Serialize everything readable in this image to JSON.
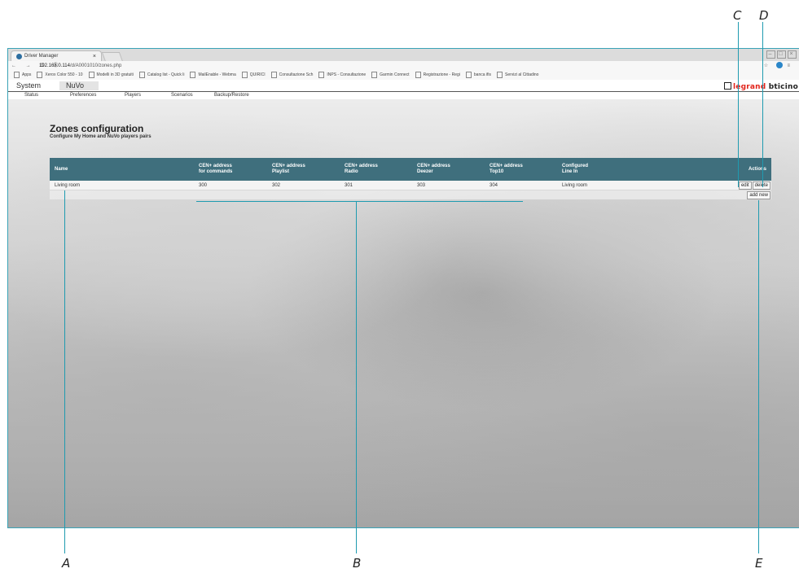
{
  "callouts": {
    "a": "A",
    "b": "B",
    "c": "C",
    "d": "D",
    "e": "E"
  },
  "browser": {
    "tab_title": "Driver Manager",
    "tab_close": "×",
    "url_host": "192.168.0.114",
    "url_path": "/d/A0001010/zones.php",
    "nav_glyphs": "← → C ⓘ",
    "bookmarks": [
      "Apps",
      "Xerox Color 550 - 10",
      "Modelli in 3D gratuiti",
      "Catalog list - Quick li",
      "MailEnable - Webma",
      "QUIRICI",
      "Consultazione Sch",
      "INPS - Consultazione",
      "Garmin Connect",
      "Registrazione - Regi",
      "banca ifis",
      "Servizi al Cittadino"
    ]
  },
  "app": {
    "top_nav": [
      "System",
      "NuVo"
    ],
    "sub_nav": [
      "Status",
      "Preferences",
      "Players",
      "Scenarios",
      "Backup/Restore"
    ],
    "brand_left": "legrand",
    "brand_right": "bticino"
  },
  "page": {
    "title": "Zones configuration",
    "subtitle": "Configure My Home and NuVo players pairs"
  },
  "table": {
    "headers": [
      [
        "Name",
        ""
      ],
      [
        "CEN+ address",
        "for commands"
      ],
      [
        "CEN+ address",
        "Playlist"
      ],
      [
        "CEN+ address",
        "Radio"
      ],
      [
        "CEN+ address",
        "Deezer"
      ],
      [
        "CEN+ address",
        "Top10"
      ],
      [
        "Configured",
        "Line In"
      ],
      [
        "Actions",
        ""
      ]
    ],
    "rows": [
      {
        "name": "Living room",
        "commands": "300",
        "playlist": "302",
        "radio": "301",
        "deezer": "303",
        "top10": "304",
        "line_in": "Living room"
      }
    ],
    "edit_label": "edit",
    "delete_label": "delete",
    "add_new_label": "add new"
  },
  "colors": {
    "header_bg": "#3f6f7d",
    "callout_line": "#1f9bb0",
    "brand_red": "#e2231a"
  }
}
